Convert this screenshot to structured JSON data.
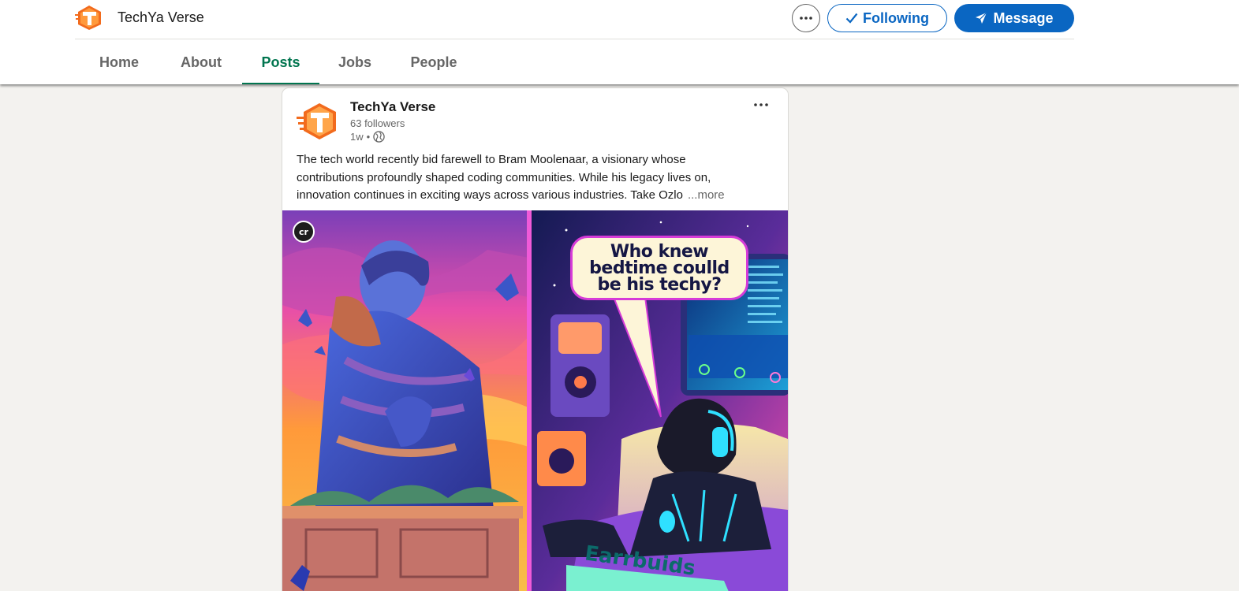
{
  "header": {
    "company_name": "TechYa Verse",
    "following_label": "Following",
    "message_label": "Message",
    "overflow_icon": "ellipsis-icon"
  },
  "tabs": [
    {
      "label": "Home",
      "active": false
    },
    {
      "label": "About",
      "active": false
    },
    {
      "label": "Posts",
      "active": true
    },
    {
      "label": "Jobs",
      "active": false
    },
    {
      "label": "People",
      "active": false
    }
  ],
  "post": {
    "author": "TechYa Verse",
    "followers": "63 followers",
    "age": "1w",
    "visibility_icon": "globe-icon",
    "commentary_lines": [
      "The tech world recently bid farewell to Bram Moolenaar, a visionary whose",
      "contributions profoundly shaped coding communities. While his legacy lives on,",
      "innovation continues in exciting ways across various industries. Take Ozlo"
    ],
    "more_label": "...more",
    "image": {
      "badge": "cr",
      "bubble_lines": [
        "Who knew",
        "bedtime coulld",
        "be his techy?"
      ],
      "box_label": "Earrbuids"
    }
  },
  "colors": {
    "brand_blue": "#0a66c2",
    "active_tab_green": "#01754f",
    "page_bg": "#f3f2ef"
  }
}
